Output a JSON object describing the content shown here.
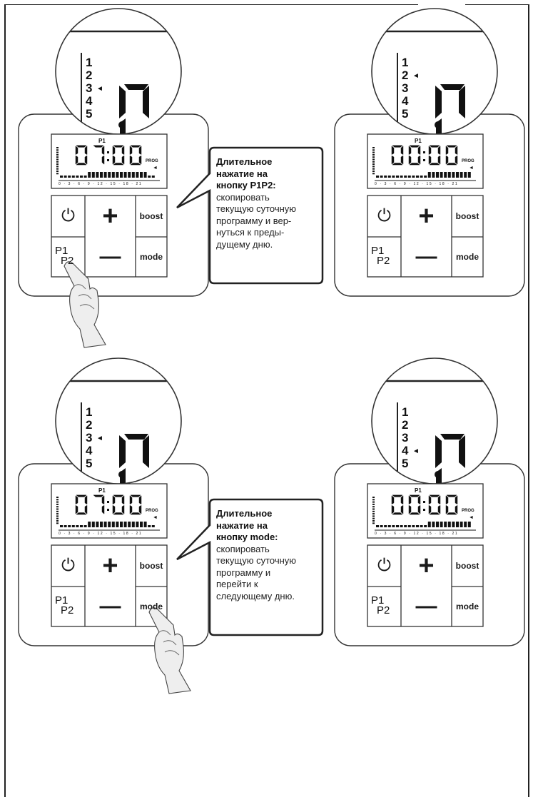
{
  "panels": [
    {
      "id": "top-left",
      "scale_numbers": [
        "1",
        "2",
        "3",
        "4",
        "5"
      ],
      "arrow_row": 3,
      "display_time": "07:00",
      "display_tag": "P1",
      "prog_label": "PROG",
      "buttons": {
        "power": "⏻",
        "plus": "+",
        "boost": "boost",
        "minus": "—",
        "p1": "P1",
        "p2": "P2",
        "mode": "mode"
      },
      "hand_on": "p1p2"
    },
    {
      "id": "top-right",
      "scale_numbers": [
        "1",
        "2",
        "3",
        "4",
        "5"
      ],
      "arrow_row": 2,
      "display_time": "00:00",
      "display_tag": "P1",
      "prog_label": "PROG",
      "buttons": {
        "power": "⏻",
        "plus": "+",
        "boost": "boost",
        "minus": "—",
        "p1": "P1",
        "p2": "P2",
        "mode": "mode"
      },
      "hand_on": ""
    },
    {
      "id": "bottom-left",
      "scale_numbers": [
        "1",
        "2",
        "3",
        "4",
        "5"
      ],
      "arrow_row": 3,
      "display_time": "07:00",
      "display_tag": "P1",
      "prog_label": "PROG",
      "buttons": {
        "power": "⏻",
        "plus": "+",
        "boost": "boost",
        "minus": "—",
        "p1": "P1",
        "p2": "P2",
        "mode": "mode"
      },
      "hand_on": "mode"
    },
    {
      "id": "bottom-right",
      "scale_numbers": [
        "1",
        "2",
        "3",
        "4",
        "5"
      ],
      "arrow_row": 4,
      "display_time": "00:00",
      "display_tag": "P1",
      "prog_label": "PROG",
      "buttons": {
        "power": "⏻",
        "plus": "+",
        "boost": "boost",
        "minus": "—",
        "p1": "P1",
        "p2": "P2",
        "mode": "mode"
      },
      "hand_on": ""
    }
  ],
  "callouts": [
    {
      "bold_lines": [
        "Длительное",
        "нажатие на",
        "кнопку P1P2:"
      ],
      "lines": [
        "скопировать",
        "текущую суточную",
        "программу и вер-",
        "нуться к преды-",
        "дущему дню."
      ]
    },
    {
      "bold_lines": [
        "Длительное",
        "нажатие на",
        "кнопку mode:"
      ],
      "lines": [
        "скопировать",
        "текущую суточную",
        "программу и",
        "перейти к",
        "следующему дню."
      ]
    }
  ],
  "display_scale_labels": "0 · 3 · 6 · 9 · 12 · 15 · 18 · 21"
}
